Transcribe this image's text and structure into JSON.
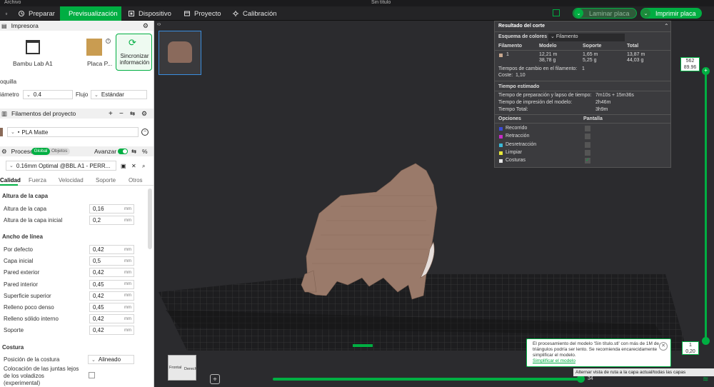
{
  "window": {
    "menu_hint": "Archivo",
    "title": "Sin título"
  },
  "tabs": [
    {
      "label": "Preparar",
      "icon": "home-icon"
    },
    {
      "label": "Previsualización",
      "icon": "preview-icon",
      "active": true
    },
    {
      "label": "Dispositivo",
      "icon": "device-icon"
    },
    {
      "label": "Proyecto",
      "icon": "project-icon"
    },
    {
      "label": "Calibración",
      "icon": "calibration-icon"
    }
  ],
  "toolbar": {
    "slice_plate": "Laminar placa",
    "print_plate": "Imprimir placa"
  },
  "printer": {
    "section": "Impresora",
    "name": "Bambu Lab A1",
    "plate": "Placa P...",
    "sync": "Sincronizar información",
    "nozzle_label": "oquilla",
    "diameter_label": "iámetro",
    "diameter_value": "0.4",
    "flow_label": "Flujo",
    "flow_value": "Estándar"
  },
  "filaments": {
    "section": "Filamentos del proyecto",
    "item": "PLA Matte"
  },
  "process": {
    "section": "Proceso",
    "global": "Global",
    "objects": "Objetos",
    "advanced": "Avanzar",
    "preset": "0.16mm Optimal @BBL A1 - PERR...",
    "tabs": [
      "Calidad",
      "Fuerza",
      "Velocidad",
      "Soporte",
      "Otros"
    ],
    "groups": [
      {
        "title": "Altura de la capa",
        "rows": [
          {
            "label": "Altura de la capa",
            "value": "0,16",
            "unit": "mm"
          },
          {
            "label": "Altura de la capa inicial",
            "value": "0,2",
            "unit": "mm"
          }
        ]
      },
      {
        "title": "Ancho de línea",
        "rows": [
          {
            "label": "Por defecto",
            "value": "0,42",
            "unit": "mm"
          },
          {
            "label": "Capa inicial",
            "value": "0,5",
            "unit": "mm"
          },
          {
            "label": "Pared exterior",
            "value": "0,42",
            "unit": "mm"
          },
          {
            "label": "Pared interior",
            "value": "0,45",
            "unit": "mm"
          },
          {
            "label": "Superficie superior",
            "value": "0,42",
            "unit": "mm"
          },
          {
            "label": "Relleno poco denso",
            "value": "0,45",
            "unit": "mm"
          },
          {
            "label": "Relleno sólido interno",
            "value": "0,42",
            "unit": "mm"
          },
          {
            "label": "Soporte",
            "value": "0,42",
            "unit": "mm"
          }
        ]
      },
      {
        "title": "Costura",
        "rows": [
          {
            "label": "Posición de la costura",
            "value": "Alineado"
          },
          {
            "label": "Colocación de las juntas lejos de los voladizos (experimental)"
          }
        ]
      }
    ]
  },
  "slice_result": {
    "title": "Resultado del corte",
    "color_scheme_label": "Esquema de colores",
    "color_scheme_value": "Filamento",
    "headers": [
      "Filamento",
      "Modelo",
      "Soporte",
      "Total"
    ],
    "row": {
      "id": "1",
      "model_len": "12,21 m",
      "model_g": "38,78 g",
      "support_len": "1,65 m",
      "support_g": "5,25 g",
      "total_len": "13,87 m",
      "total_g": "44,03 g"
    },
    "changes_label": "Tiempos de cambio en el filamento:",
    "changes_value": "1",
    "cost_label": "Coste:",
    "cost_value": "1,10",
    "time_title": "Tiempo estimado",
    "prep_label": "Tiempo de preparación y lapso de tiempo:",
    "prep_value": "7m10s + 15m36s",
    "model_time_label": "Tiempo de impresión del modelo:",
    "model_time_value": "2h46m",
    "total_label": "Tiempo Total:",
    "total_value": "3h9m",
    "options_label": "Opciones",
    "display_label": "Pantalla",
    "options": [
      {
        "name": "Recorrido",
        "color": "#3b4bd6",
        "checked": false
      },
      {
        "name": "Retracción",
        "color": "#c82cc8",
        "checked": false
      },
      {
        "name": "Desretracción",
        "color": "#3ab8d6",
        "checked": false
      },
      {
        "name": "Limpiar",
        "color": "#e8e83a",
        "checked": false
      },
      {
        "name": "Costuras",
        "color": "#e6e6e6",
        "checked": true
      }
    ]
  },
  "layer_slider": {
    "top_layer": "562",
    "top_height": "89.96",
    "bottom_layer": "1",
    "bottom_height": "0,20"
  },
  "h_slider": {
    "value": "34",
    "tooltip": "Alternar vista de ruta a la capa actual/todas las capas"
  },
  "notice": {
    "text": "El procesamiento del modelo 'Sin título.stl' con más de 1M de triángulos podría ser lento. Se recomienda encarecidamente simplificar el modelo.",
    "link": "Simplificar el modelo"
  },
  "cube": {
    "front": "Frontal",
    "right": "Derecha"
  }
}
